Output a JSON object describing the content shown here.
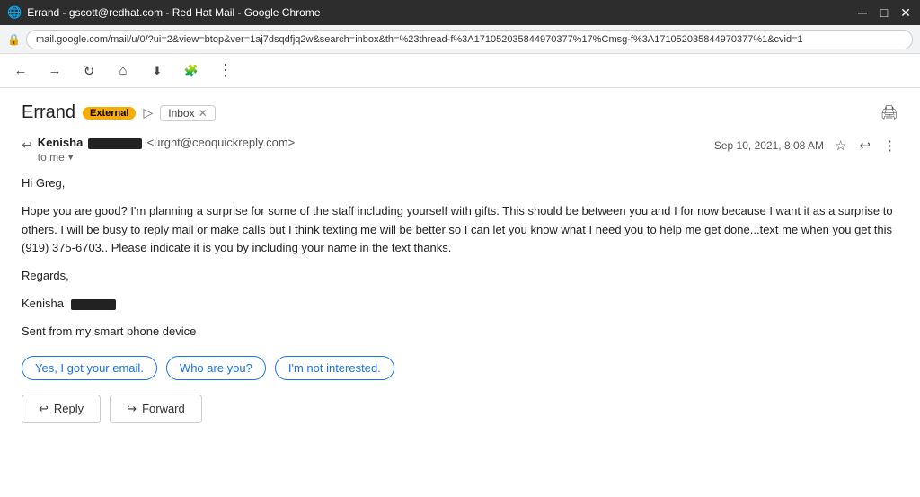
{
  "titleBar": {
    "title": "Errand - gscott@redhat.com - Red Hat Mail - Google Chrome",
    "controls": [
      "minimize",
      "maximize",
      "close"
    ]
  },
  "addressBar": {
    "url": "mail.google.com/mail/u/0/?ui=2&view=btop&ver=1aj7dsqdfjq2w&search=inbox&th=%23thread-f%3A171052035844970377%17%Cmsg-f%3A171052035844970377%1&cvid=1",
    "lock": "🔒"
  },
  "toolbar": {
    "icons": [
      "back",
      "forward",
      "reload",
      "home",
      "downloads",
      "extensions",
      "more"
    ]
  },
  "email": {
    "subject": "Errand",
    "label_external": "External",
    "label_inbox": "Inbox",
    "sender_name": "Kenisha",
    "sender_email": "<urgnt@ceoquickreply.com>",
    "to_label": "to me",
    "date": "Sep 10, 2021, 8:08 AM",
    "greeting": "Hi Greg,",
    "body_paragraph": "Hope you are good? I'm planning a surprise for some of the staff including yourself with gifts. This should be between you and I for now because I want it as a surprise to others. I will be busy to reply mail or make calls but I think texting me will be better so I can let you know what I need you to help me get done...text me when you get this (919) 375-6703.. Please indicate it is you by including your name in the text thanks.",
    "regards": "Regards,",
    "sender_sign": "Kenisha",
    "sent_from": "Sent from my smart phone device",
    "smart_replies": [
      "Yes, I got your email.",
      "Who are you?",
      "I'm not interested."
    ],
    "reply_label": "Reply",
    "forward_label": "Forward"
  }
}
